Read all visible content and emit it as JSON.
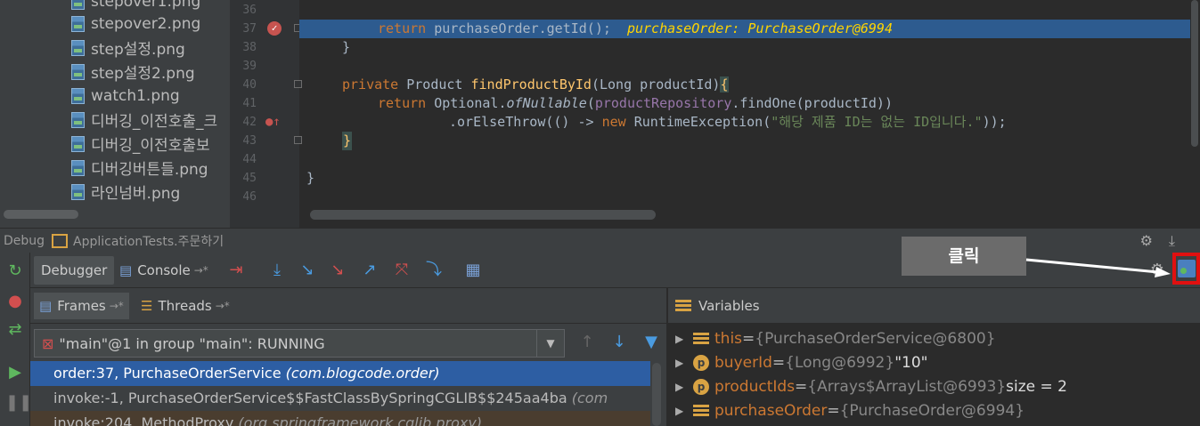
{
  "project_tree": {
    "files": [
      "stepover1.png",
      "stepover2.png",
      "step설정.png",
      "step설정2.png",
      "watch1.png",
      "디버깅_이전호출_크",
      "디버깅_이전호출보",
      "디버깅버튼들.png",
      "라인넘버.png"
    ]
  },
  "editor": {
    "line_numbers": [
      "36",
      "37",
      "38",
      "39",
      "40",
      "41",
      "42",
      "43",
      "44",
      "45",
      "46"
    ],
    "line37": {
      "kw": "return",
      "code": " purchaseOrder.getId();",
      "debug_value": "purchaseOrder: PurchaseOrder@6994"
    },
    "line38": "}",
    "line40": {
      "kw": "private",
      "type": " Product ",
      "fn": "findProductById",
      "params": "(Long productId)",
      "brace": "{"
    },
    "line41": {
      "kw": "return",
      "pre": " Optional.",
      "method": "ofNullable",
      "open": "(",
      "field": "productRepository",
      "rest": ".findOne(productId))"
    },
    "line42": {
      "pre": ".orElseThrow(() -> ",
      "kw": "new",
      "cls": " RuntimeException(",
      "str": "\"해당 제품 ID는 없는 ID입니다.\"",
      "end": "));"
    },
    "line43": "}",
    "line45": "}"
  },
  "debug_title": {
    "label": "Debug",
    "config": "ApplicationTests.주문하기"
  },
  "toolbar": {
    "debugger_tab": "Debugger",
    "console_tab": "Console",
    "pin": "→*"
  },
  "frames_panel": {
    "frames_tab": "Frames",
    "threads_tab": "Threads",
    "pin": "→*",
    "thread_combo": "\"main\"@1 in group \"main\": RUNNING",
    "rows": [
      {
        "method": "order:37, PurchaseOrderService ",
        "pkg": "(com.blogcode.order)"
      },
      {
        "method": "invoke:-1, PurchaseOrderService$$FastClassBySpringCGLIB$$245aa4ba ",
        "pkg": "(com"
      },
      {
        "method": "invoke:204, MethodProxy ",
        "pkg": "(org.springframework.cglib.proxy)"
      }
    ]
  },
  "variables_panel": {
    "title": "Variables",
    "rows": [
      {
        "name": "this",
        "eq": " = ",
        "val": "{PurchaseOrderService@6800}",
        "extra": ""
      },
      {
        "name": "buyerId",
        "eq": " = ",
        "val": "{Long@6992} ",
        "extra": "\"10\""
      },
      {
        "name": "productIds",
        "eq": " = ",
        "val": "{Arrays$ArrayList@6993} ",
        "extra": " size = 2"
      },
      {
        "name": "purchaseOrder",
        "eq": " = ",
        "val": "{PurchaseOrder@6994}",
        "extra": ""
      }
    ]
  },
  "annotation": {
    "callout": "클릭"
  }
}
